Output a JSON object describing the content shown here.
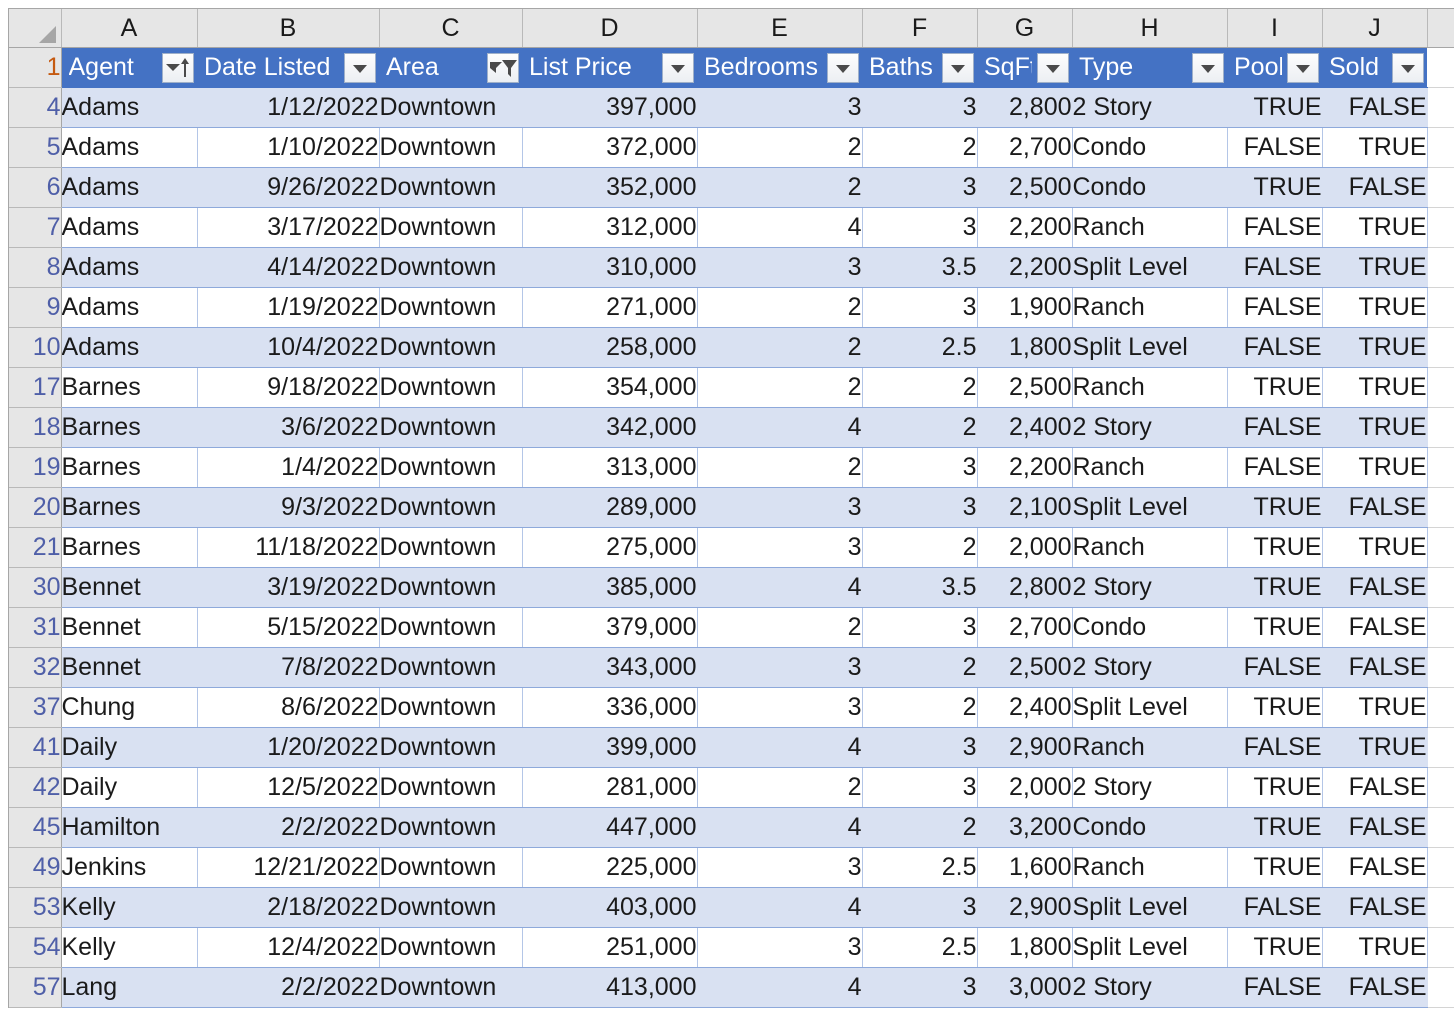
{
  "app": {
    "type": "spreadsheet",
    "name": "excel-filtered-table"
  },
  "colors": {
    "header_fill": "#4472C4",
    "header_text": "#FFFFFF",
    "band_fill": "#D9E1F2",
    "band_border": "#8EA9DB",
    "rowhead_fill": "#E6E6E6",
    "rowhead_filtered_text": "#4F5FA8",
    "rowhead_active_text": "#C55A11"
  },
  "column_letters": [
    "A",
    "B",
    "C",
    "D",
    "E",
    "F",
    "G",
    "H",
    "I",
    "J"
  ],
  "corner": {
    "icon": "select-all-triangle-icon"
  },
  "table": {
    "header_row_number": "1",
    "columns": [
      {
        "letter": "A",
        "label": "Agent",
        "align": "left",
        "filter_icon": "sort-ascending-dropdown-icon"
      },
      {
        "letter": "B",
        "label": "Date Listed",
        "align": "right",
        "filter_icon": "dropdown-arrow-icon"
      },
      {
        "letter": "C",
        "label": "Area",
        "align": "left",
        "filter_icon": "filter-funnel-icon"
      },
      {
        "letter": "D",
        "label": "List Price",
        "align": "right",
        "filter_icon": "dropdown-arrow-icon"
      },
      {
        "letter": "E",
        "label": "Bedrooms",
        "align": "right",
        "filter_icon": "dropdown-arrow-icon"
      },
      {
        "letter": "F",
        "label": "Baths",
        "align": "right",
        "filter_icon": "dropdown-arrow-icon"
      },
      {
        "letter": "G",
        "label": "SqFt",
        "align": "right",
        "filter_icon": "dropdown-arrow-icon"
      },
      {
        "letter": "H",
        "label": "Type",
        "align": "left",
        "filter_icon": "dropdown-arrow-icon"
      },
      {
        "letter": "I",
        "label": "Pool",
        "align": "right",
        "filter_icon": "dropdown-arrow-icon"
      },
      {
        "letter": "J",
        "label": "Sold",
        "align": "right",
        "filter_icon": "dropdown-arrow-icon"
      }
    ],
    "rows": [
      {
        "n": "4",
        "cells": [
          "Adams",
          "1/12/2022",
          "Downtown",
          "397,000",
          "3",
          "3",
          "2,800",
          "2 Story",
          "TRUE",
          "FALSE"
        ]
      },
      {
        "n": "5",
        "cells": [
          "Adams",
          "1/10/2022",
          "Downtown",
          "372,000",
          "2",
          "2",
          "2,700",
          "Condo",
          "FALSE",
          "TRUE"
        ]
      },
      {
        "n": "6",
        "cells": [
          "Adams",
          "9/26/2022",
          "Downtown",
          "352,000",
          "2",
          "3",
          "2,500",
          "Condo",
          "TRUE",
          "FALSE"
        ]
      },
      {
        "n": "7",
        "cells": [
          "Adams",
          "3/17/2022",
          "Downtown",
          "312,000",
          "4",
          "3",
          "2,200",
          "Ranch",
          "FALSE",
          "TRUE"
        ]
      },
      {
        "n": "8",
        "cells": [
          "Adams",
          "4/14/2022",
          "Downtown",
          "310,000",
          "3",
          "3.5",
          "2,200",
          "Split Level",
          "FALSE",
          "TRUE"
        ]
      },
      {
        "n": "9",
        "cells": [
          "Adams",
          "1/19/2022",
          "Downtown",
          "271,000",
          "2",
          "3",
          "1,900",
          "Ranch",
          "FALSE",
          "TRUE"
        ]
      },
      {
        "n": "10",
        "cells": [
          "Adams",
          "10/4/2022",
          "Downtown",
          "258,000",
          "2",
          "2.5",
          "1,800",
          "Split Level",
          "FALSE",
          "TRUE"
        ]
      },
      {
        "n": "17",
        "cells": [
          "Barnes",
          "9/18/2022",
          "Downtown",
          "354,000",
          "2",
          "2",
          "2,500",
          "Ranch",
          "TRUE",
          "TRUE"
        ]
      },
      {
        "n": "18",
        "cells": [
          "Barnes",
          "3/6/2022",
          "Downtown",
          "342,000",
          "4",
          "2",
          "2,400",
          "2 Story",
          "FALSE",
          "TRUE"
        ]
      },
      {
        "n": "19",
        "cells": [
          "Barnes",
          "1/4/2022",
          "Downtown",
          "313,000",
          "2",
          "3",
          "2,200",
          "Ranch",
          "FALSE",
          "TRUE"
        ]
      },
      {
        "n": "20",
        "cells": [
          "Barnes",
          "9/3/2022",
          "Downtown",
          "289,000",
          "3",
          "3",
          "2,100",
          "Split Level",
          "TRUE",
          "FALSE"
        ]
      },
      {
        "n": "21",
        "cells": [
          "Barnes",
          "11/18/2022",
          "Downtown",
          "275,000",
          "3",
          "2",
          "2,000",
          "Ranch",
          "TRUE",
          "TRUE"
        ]
      },
      {
        "n": "30",
        "cells": [
          "Bennet",
          "3/19/2022",
          "Downtown",
          "385,000",
          "4",
          "3.5",
          "2,800",
          "2 Story",
          "TRUE",
          "FALSE"
        ]
      },
      {
        "n": "31",
        "cells": [
          "Bennet",
          "5/15/2022",
          "Downtown",
          "379,000",
          "2",
          "3",
          "2,700",
          "Condo",
          "TRUE",
          "FALSE"
        ]
      },
      {
        "n": "32",
        "cells": [
          "Bennet",
          "7/8/2022",
          "Downtown",
          "343,000",
          "3",
          "2",
          "2,500",
          "2 Story",
          "FALSE",
          "FALSE"
        ]
      },
      {
        "n": "37",
        "cells": [
          "Chung",
          "8/6/2022",
          "Downtown",
          "336,000",
          "3",
          "2",
          "2,400",
          "Split Level",
          "TRUE",
          "TRUE"
        ]
      },
      {
        "n": "41",
        "cells": [
          "Daily",
          "1/20/2022",
          "Downtown",
          "399,000",
          "4",
          "3",
          "2,900",
          "Ranch",
          "FALSE",
          "TRUE"
        ]
      },
      {
        "n": "42",
        "cells": [
          "Daily",
          "12/5/2022",
          "Downtown",
          "281,000",
          "2",
          "3",
          "2,000",
          "2 Story",
          "TRUE",
          "FALSE"
        ]
      },
      {
        "n": "45",
        "cells": [
          "Hamilton",
          "2/2/2022",
          "Downtown",
          "447,000",
          "4",
          "2",
          "3,200",
          "Condo",
          "TRUE",
          "FALSE"
        ]
      },
      {
        "n": "49",
        "cells": [
          "Jenkins",
          "12/21/2022",
          "Downtown",
          "225,000",
          "3",
          "2.5",
          "1,600",
          "Ranch",
          "TRUE",
          "FALSE"
        ]
      },
      {
        "n": "53",
        "cells": [
          "Kelly",
          "2/18/2022",
          "Downtown",
          "403,000",
          "4",
          "3",
          "2,900",
          "Split Level",
          "FALSE",
          "FALSE"
        ]
      },
      {
        "n": "54",
        "cells": [
          "Kelly",
          "12/4/2022",
          "Downtown",
          "251,000",
          "3",
          "2.5",
          "1,800",
          "Split Level",
          "TRUE",
          "TRUE"
        ]
      },
      {
        "n": "57",
        "cells": [
          "Lang",
          "2/2/2022",
          "Downtown",
          "413,000",
          "4",
          "3",
          "3,000",
          "2 Story",
          "FALSE",
          "FALSE"
        ]
      }
    ]
  }
}
